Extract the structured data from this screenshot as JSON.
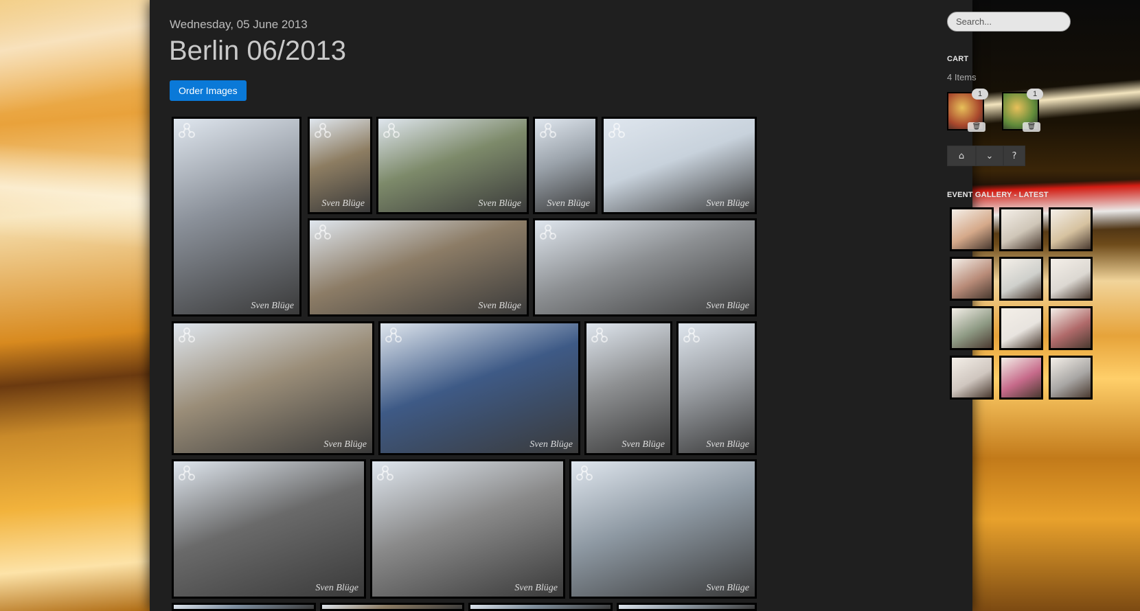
{
  "post": {
    "date": "Wednesday, 05 June 2013",
    "title": "Berlin 06/2013",
    "order_label": "Order Images"
  },
  "gallery": {
    "watermark": "Sven Blüge",
    "tiles": [
      {
        "subject": "TV tower and railway bridge",
        "color": "#8a9099"
      },
      {
        "subject": "Berlin Cathedral",
        "color": "#8d7d62"
      },
      {
        "subject": "Alte Nationalgalerie",
        "color": "#7d8a6a"
      },
      {
        "subject": "Construction crane",
        "color": "#9aa2aa"
      },
      {
        "subject": "Aeroflot sky",
        "color": "#c8d2dc"
      },
      {
        "subject": "Brandenburg Gate crowd",
        "color": "#8c7c66"
      },
      {
        "subject": "Street scene with TV tower",
        "color": "#8c8f92"
      },
      {
        "subject": "Brandenburg Gate",
        "color": "#9a8d78"
      },
      {
        "subject": "Holocaust Memorial blocks",
        "color": "#3e5a86"
      },
      {
        "subject": "Memorial alley",
        "color": "#8e9092"
      },
      {
        "subject": "Memorial alley 2",
        "color": "#9b9fa4"
      },
      {
        "subject": "Concrete stele",
        "color": "#6a6a6a"
      },
      {
        "subject": "Concrete texture",
        "color": "#8a8a8a"
      },
      {
        "subject": "Memorial with cranes",
        "color": "#8d98a2"
      },
      {
        "subject": "Bottom row 1",
        "color": "#7b8b9c"
      },
      {
        "subject": "Bottom row 2",
        "color": "#8a7a62"
      },
      {
        "subject": "Bottom row 3",
        "color": "#7f8e9b"
      },
      {
        "subject": "Bottom row 4",
        "color": "#8f9aa4"
      }
    ]
  },
  "sidebar": {
    "search_placeholder": "Search...",
    "cart_heading": "CART",
    "cart_count": "4 Items",
    "cart_items": [
      {
        "qty": "1",
        "color": "#a8472c",
        "remove_label": "🗑"
      },
      {
        "qty": "1",
        "color": "#5f8a3a",
        "remove_label": "🗑"
      }
    ],
    "cart_tools": {
      "home_icon": "⌂",
      "menu_icon": "⌄",
      "help_label": "?"
    },
    "event_heading": "EVENT GALLERY - LATEST",
    "event_thumbs": [
      {
        "color": "#d5a98a"
      },
      {
        "color": "#cfc6b8"
      },
      {
        "color": "#d6c2a0"
      },
      {
        "color": "#b88b78"
      },
      {
        "color": "#cfd0cc"
      },
      {
        "color": "#dcd8d2"
      },
      {
        "color": "#8e9a84"
      },
      {
        "color": "#e8e4df"
      },
      {
        "color": "#b06a6a"
      },
      {
        "color": "#cfc6bf"
      },
      {
        "color": "#c66a8a"
      },
      {
        "color": "#a8a6a4"
      }
    ]
  }
}
